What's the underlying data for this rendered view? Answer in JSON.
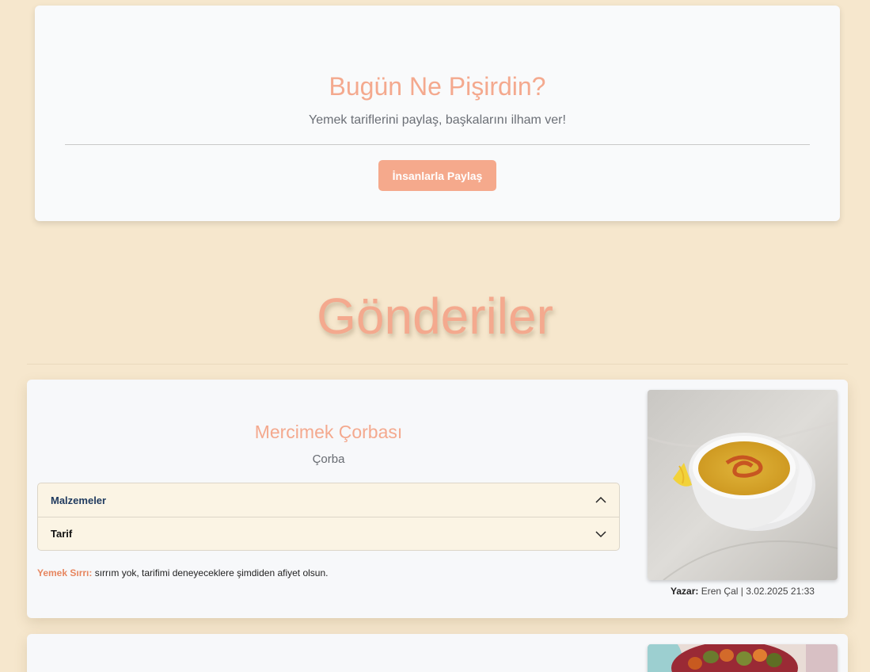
{
  "hero": {
    "title": "Bugün Ne Pişirdin?",
    "subtitle": "Yemek tariflerini paylaş, başkalarını ilham ver!",
    "share_button": "İnsanlarla Paylaş"
  },
  "posts_section": {
    "title": "Gönderiler"
  },
  "posts": [
    {
      "title": "Mercimek Çorbası",
      "category": "Çorba",
      "accordion": [
        {
          "label": "Malzemeler",
          "state": "expanded-icon",
          "icon": "chevron-up-icon"
        },
        {
          "label": "Tarif",
          "state": "collapsed-icon",
          "icon": "chevron-down-icon"
        }
      ],
      "secret_label": "Yemek Sırrı:",
      "secret_text": " sırrım yok, tarifimi deneyeceklere şimdiden afiyet olsun.",
      "author_label": "Yazar:",
      "author_info": " Eren Çal | 3.02.2025 21:33",
      "image": "lentil-soup-photo"
    },
    {
      "image": "pickles-photo"
    }
  ],
  "colors": {
    "background": "#f6e7cd",
    "accent": "#f4a98e",
    "button": "#f5a98c",
    "secret_label": "#e7865f",
    "accordion_bg": "#fbf4e4"
  }
}
